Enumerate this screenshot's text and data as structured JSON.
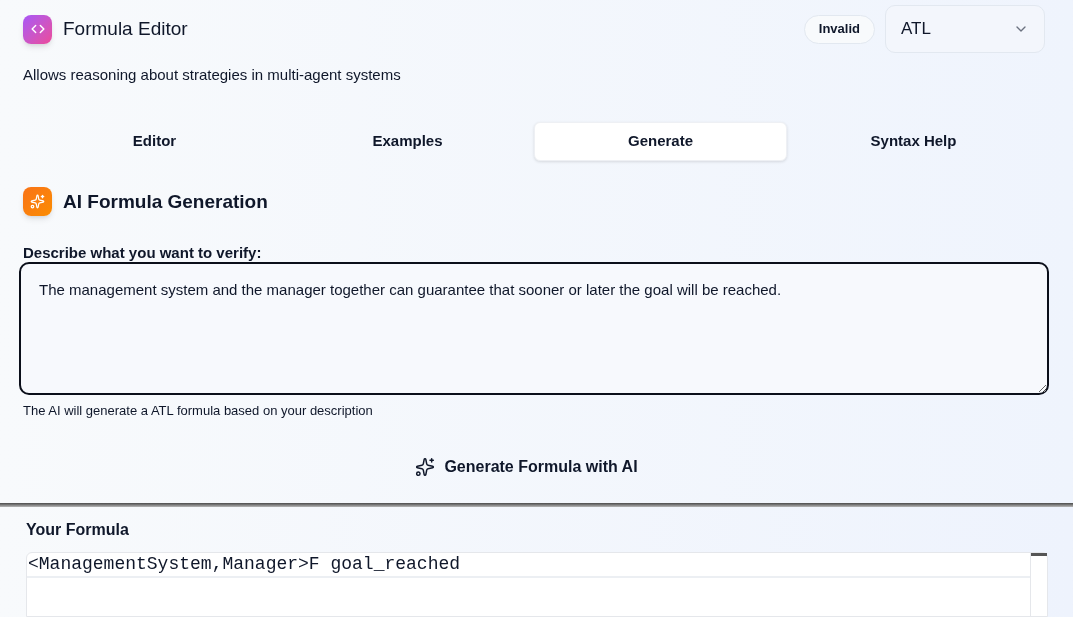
{
  "header": {
    "title": "Formula Editor",
    "status_badge": "Invalid",
    "logic_select": {
      "value": "ATL"
    }
  },
  "description": "Allows reasoning about strategies in multi-agent systems",
  "tabs": [
    {
      "label": "Editor",
      "selected": false
    },
    {
      "label": "Examples",
      "selected": false
    },
    {
      "label": "Generate",
      "selected": true
    },
    {
      "label": "Syntax Help",
      "selected": false
    }
  ],
  "generation": {
    "title": "AI Formula Generation",
    "prompt_label": "Describe what you want to verify:",
    "prompt": {
      "value": "The management system and the manager together can guarantee that sooner or later the goal will be reached.",
      "focused": true
    },
    "hint": "The AI will generate a ATL formula based on your description",
    "generate_button": "Generate Formula with AI"
  },
  "formula_panel": {
    "title": "Your Formula",
    "lines": [
      "<ManagementSystem,Manager>F goal_reached"
    ]
  }
}
